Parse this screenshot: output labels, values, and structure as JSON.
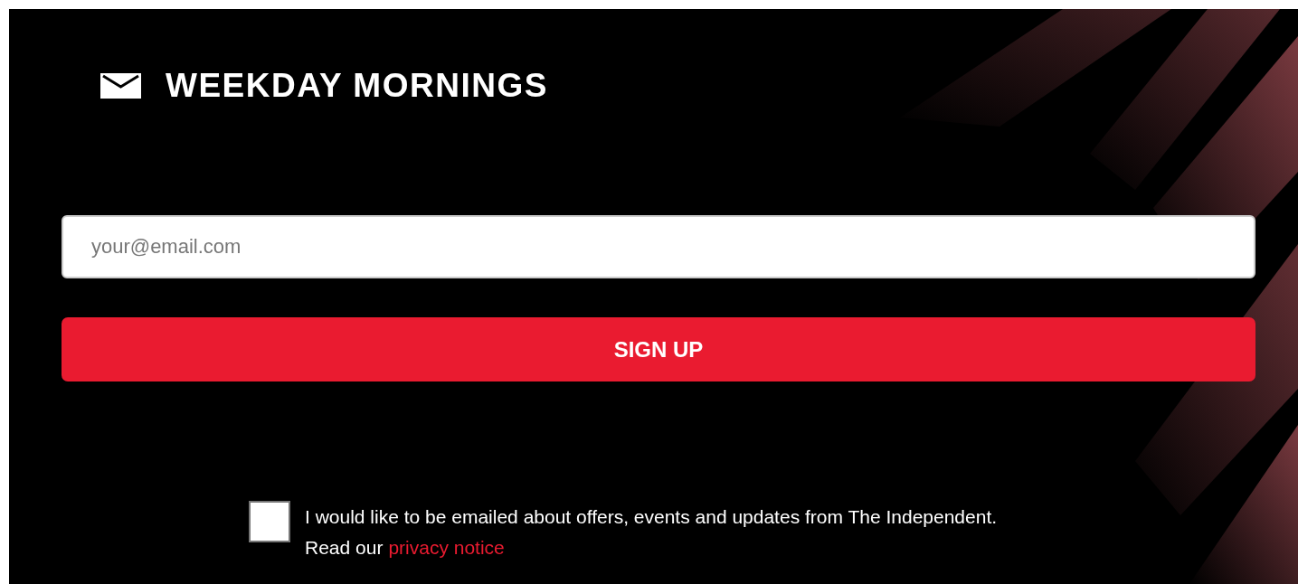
{
  "banner": {
    "title": "WEEKDAY MORNINGS"
  },
  "email_field": {
    "placeholder": "your@email.com"
  },
  "signup_button": {
    "label": "SIGN UP"
  },
  "consent": {
    "checked": false,
    "text": "I would like to be emailed about offers, events and updates from The Independent.",
    "prefix": "Read our",
    "link": "privacy notice"
  }
}
